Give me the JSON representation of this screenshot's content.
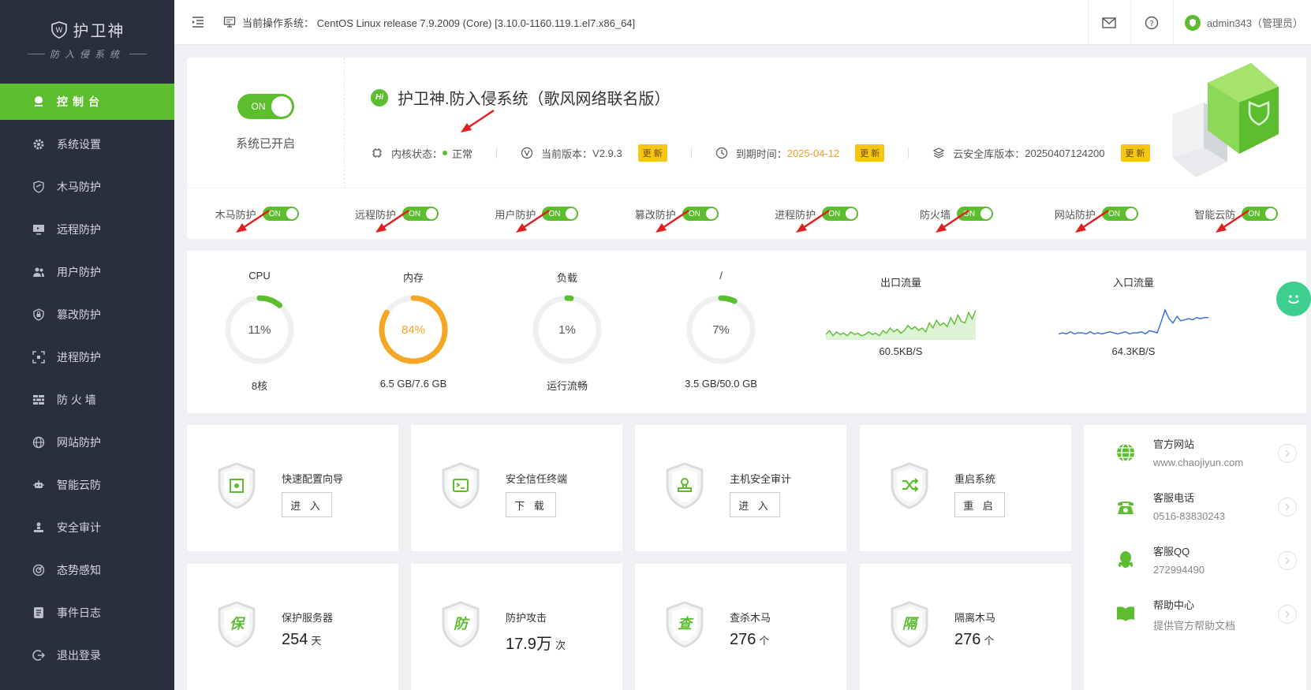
{
  "brand": {
    "name": "护卫神",
    "subtitle": "防入侵系统"
  },
  "nav": [
    {
      "label": "控制台",
      "icon": "dashboard-icon",
      "active": true
    },
    {
      "label": "系统设置",
      "icon": "gear-icon"
    },
    {
      "label": "木马防护",
      "icon": "trojan-shield-icon"
    },
    {
      "label": "远程防护",
      "icon": "remote-desktop-icon"
    },
    {
      "label": "用户防护",
      "icon": "users-icon"
    },
    {
      "label": "篡改防护",
      "icon": "lock-gear-icon"
    },
    {
      "label": "进程防护",
      "icon": "process-scan-icon"
    },
    {
      "label": "防 火 墙",
      "icon": "firewall-icon"
    },
    {
      "label": "网站防护",
      "icon": "globe-icon"
    },
    {
      "label": "智能云防",
      "icon": "robot-icon"
    },
    {
      "label": "安全审计",
      "icon": "audit-icon"
    },
    {
      "label": "态势感知",
      "icon": "radar-icon"
    },
    {
      "label": "事件日志",
      "icon": "log-icon"
    },
    {
      "label": "退出登录",
      "icon": "logout-icon"
    }
  ],
  "header": {
    "os_label": "当前操作系统：",
    "os_value": "CentOS Linux release 7.9.2009 (Core) [3.10.0-1160.119.1.el7.x86_64]",
    "user": "admin343（管理员）"
  },
  "system": {
    "switch_label": "ON",
    "status_text": "系统已开启",
    "product_title": "护卫神.防入侵系统（歌风网络联名版）",
    "hi": "Hi",
    "kernel_label": "内核状态：",
    "kernel_value": "正常",
    "version_label": "当前版本：",
    "version_value": "V2.9.3",
    "expire_label": "到期时间：",
    "expire_value": "2025-04-12",
    "cloud_label": "云安全库版本：",
    "cloud_value": "20250407124200",
    "update_label": "更 新",
    "accent_color": "#5cbd2e"
  },
  "toggles": [
    {
      "label": "木马防护",
      "state": "ON"
    },
    {
      "label": "远程防护",
      "state": "ON"
    },
    {
      "label": "用户防护",
      "state": "ON"
    },
    {
      "label": "篡改防护",
      "state": "ON"
    },
    {
      "label": "进程防护",
      "state": "ON"
    },
    {
      "label": "防火墙",
      "state": "ON"
    },
    {
      "label": "网站防护",
      "state": "ON"
    },
    {
      "label": "智能云防",
      "state": "ON"
    }
  ],
  "gauges": [
    {
      "label": "CPU",
      "value": 11,
      "text": "11%",
      "sub": "8核",
      "color": "#5cbd2e"
    },
    {
      "label": "内存",
      "value": 84,
      "text": "84%",
      "sub": "6.5 GB/7.6 GB",
      "color": "#f5a623"
    },
    {
      "label": "负载",
      "value": 1,
      "text": "1%",
      "sub": "运行流畅",
      "color": "#5cbd2e"
    },
    {
      "label": "/",
      "value": 7,
      "text": "7%",
      "sub": "3.5 GB/50.0 GB",
      "color": "#5cbd2e"
    }
  ],
  "traffic": [
    {
      "label": "出口流量",
      "value": "60.5KB/S",
      "color": "#5cbd2e",
      "fill": true,
      "points": [
        3,
        6,
        2,
        5,
        3,
        4,
        2,
        5,
        3,
        4,
        2,
        3,
        5,
        3,
        4,
        2,
        6,
        4,
        8,
        5,
        7,
        4,
        6,
        10,
        7,
        9,
        6,
        8,
        5,
        12,
        8,
        14,
        10,
        12,
        9,
        16,
        11,
        18,
        13,
        12,
        20,
        15,
        22
      ]
    },
    {
      "label": "入口流量",
      "value": "64.3KB/S",
      "color": "#2f6bd9",
      "fill": false,
      "points": [
        4,
        5,
        4,
        6,
        4,
        5,
        5,
        4,
        6,
        4,
        5,
        4,
        5,
        6,
        5,
        4,
        5,
        6,
        4,
        5,
        5,
        6,
        4,
        7,
        6,
        5,
        15,
        26,
        18,
        14,
        20,
        16,
        17,
        18,
        17,
        19,
        18,
        19,
        19
      ]
    }
  ],
  "cards": [
    {
      "title": "快速配置向导",
      "button": "进 入",
      "icon": "config-shield-icon",
      "glyph": ""
    },
    {
      "title": "安全信任终端",
      "button": "下 载",
      "icon": "terminal-shield-icon",
      "glyph": ""
    },
    {
      "title": "主机安全审计",
      "button": "进 入",
      "icon": "stamp-shield-icon",
      "glyph": ""
    },
    {
      "title": "重启系统",
      "button": "重 启",
      "icon": "shuffle-shield-icon",
      "glyph": ""
    },
    {
      "title": "保护服务器",
      "value": "254",
      "unit": "天",
      "icon": "protect-shield-icon",
      "glyph": "保"
    },
    {
      "title": "防护攻击",
      "value": "17.9万",
      "unit": "次",
      "icon": "defend-shield-icon",
      "glyph": "防"
    },
    {
      "title": "查杀木马",
      "value": "276",
      "unit": "个",
      "icon": "scan-shield-icon",
      "glyph": "查"
    },
    {
      "title": "隔离木马",
      "value": "276",
      "unit": "个",
      "icon": "isolate-shield-icon",
      "glyph": "隔"
    }
  ],
  "contacts": [
    {
      "name": "官方网站",
      "info": "www.chaojiyun.com",
      "icon": "globe-icon"
    },
    {
      "name": "客服电话",
      "info": "0516-83830243",
      "icon": "phone-icon"
    },
    {
      "name": "客服QQ",
      "info": "272994490",
      "icon": "qq-penguin-icon"
    },
    {
      "name": "帮助中心",
      "info": "提供官方帮助文档",
      "icon": "book-icon"
    }
  ]
}
